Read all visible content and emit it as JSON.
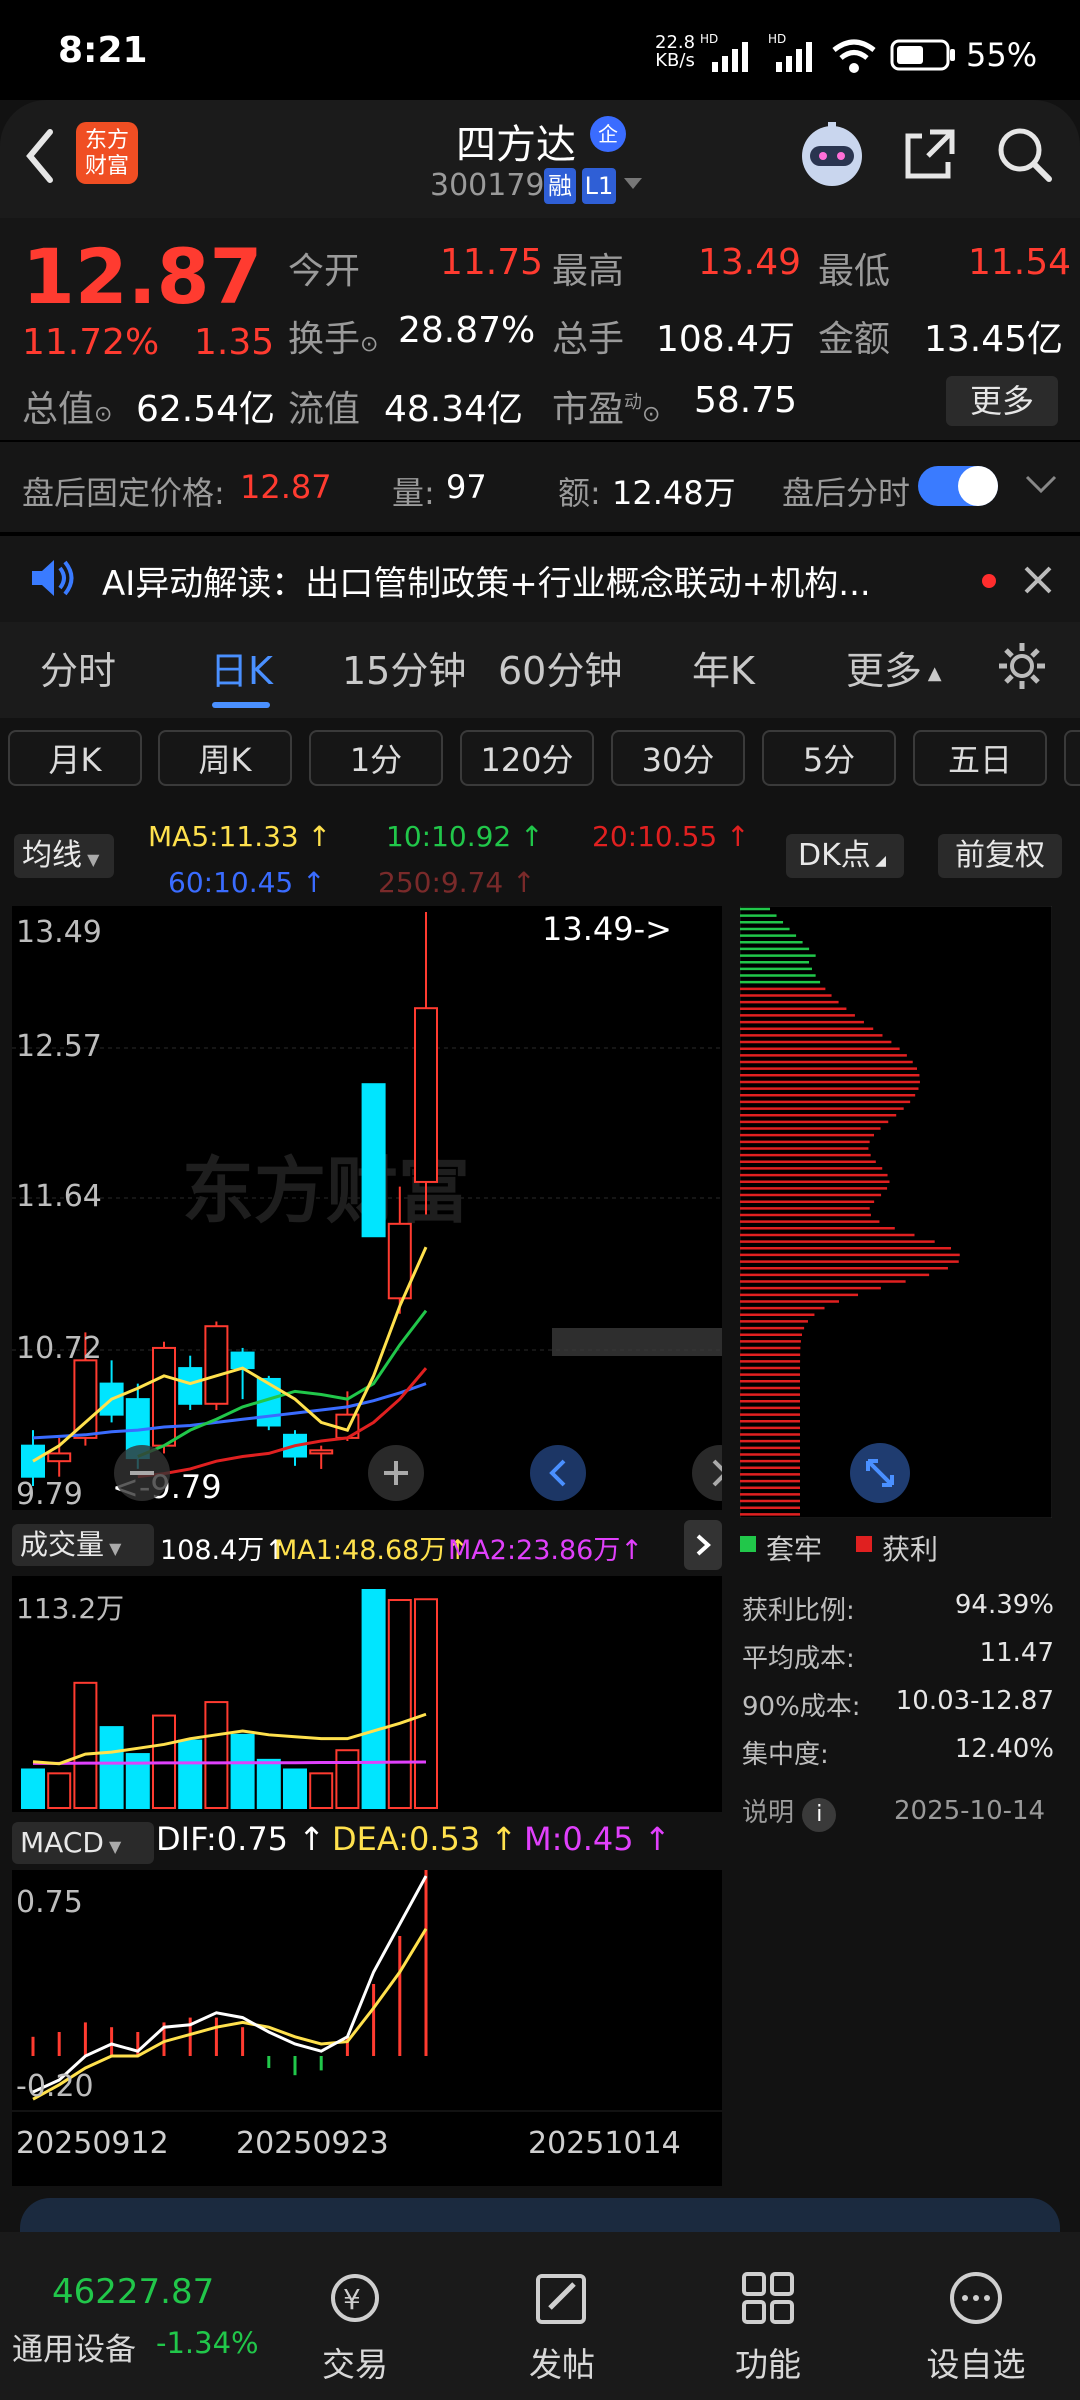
{
  "status": {
    "time": "8:21",
    "net_speed": "22.8",
    "net_unit": "KB/s",
    "hd1": "HD",
    "hd2": "HD",
    "battery": "55%"
  },
  "header": {
    "logo_line1": "东方",
    "logo_line2": "财富",
    "title": "四方达",
    "title_badge": "企",
    "code": "300179",
    "tag_rong": "融",
    "tag_level": "L1"
  },
  "quote": {
    "price": "12.87",
    "pct": "11.72%",
    "change": "1.35",
    "open_label": "今开",
    "open": "11.75",
    "high_label": "最高",
    "high": "13.49",
    "low_label": "最低",
    "low": "11.54",
    "turnover_label": "换手",
    "turnover": "28.87%",
    "volume_label": "总手",
    "volume": "108.4万",
    "amount_label": "金额",
    "amount": "13.45亿",
    "mktcap_label": "总值",
    "mktcap": "62.54亿",
    "float_label": "流值",
    "float": "48.34亿",
    "pe_label": "市盈",
    "pe_sup": "动",
    "pe": "58.75",
    "more": "更多"
  },
  "after_hours": {
    "price_label": "盘后固定价格:",
    "price": "12.87",
    "vol_label": "量:",
    "vol": "97",
    "amt_label": "额:",
    "amt": "12.48万",
    "toggle_label": "盘后分时"
  },
  "ai_banner": {
    "text": "AI异动解读：出口管制政策+行业概念联动+机构..."
  },
  "tabs": [
    {
      "label": "分时"
    },
    {
      "label": "日K"
    },
    {
      "label": "15分钟"
    },
    {
      "label": "60分钟"
    },
    {
      "label": "年K"
    },
    {
      "label": "更多"
    }
  ],
  "chips": [
    {
      "label": "月K"
    },
    {
      "label": "周K"
    },
    {
      "label": "1分"
    },
    {
      "label": "120分"
    },
    {
      "label": "30分"
    },
    {
      "label": "5分"
    },
    {
      "label": "五日"
    }
  ],
  "ma_legend": {
    "selector": "均线",
    "ma5": "MA5:11.33",
    "ma10": "10:10.92",
    "ma20": "20:10.55",
    "ma60": "60:10.45",
    "ma250": "250:9.74",
    "dk": "DK点",
    "fq": "前复权"
  },
  "kline_axis": {
    "y1": "13.49",
    "y2": "12.57",
    "y3": "11.64",
    "y4": "10.72",
    "y5": "9.79",
    "max_mark": "13.49->",
    "min_mark": "<-9.79",
    "watermark": "东方财富"
  },
  "vol_legend": {
    "selector": "成交量",
    "vol": "108.4万",
    "ma1": "MA1:48.68万",
    "ma2": "MA2:23.86万",
    "axis_top": "113.2万"
  },
  "macd_legend": {
    "selector": "MACD",
    "dif": "DIF:0.75",
    "dea": "DEA:0.53",
    "m": "M:0.45",
    "axis_top": "0.75",
    "axis_bottom": "-0.20"
  },
  "dates": [
    "20250912",
    "20250923",
    "20251014"
  ],
  "chip_panel": {
    "legend_trap": "套牢",
    "legend_profit": "获利",
    "rows": [
      {
        "label": "获利比例:",
        "value": "94.39%"
      },
      {
        "label": "平均成本:",
        "value": "11.47"
      },
      {
        "label": "90%成本:",
        "value": "10.03-12.87"
      },
      {
        "label": "集中度:",
        "value": "12.40%"
      }
    ],
    "note_label": "说明",
    "date": "2025-10-14"
  },
  "bottom_bar": {
    "index_value": "46227.87",
    "index_name": "通用设备",
    "index_pct": "-1.34%",
    "items": [
      {
        "label": "交易"
      },
      {
        "label": "发帖"
      },
      {
        "label": "功能"
      },
      {
        "label": "设自选"
      }
    ]
  },
  "colors": {
    "up": "#ff3b30",
    "down": "#00e5ff",
    "ma5": "#ffe14d",
    "ma10": "#21c74a",
    "ma20": "#e02020",
    "ma60": "#3a6cff",
    "accent": "#4a90ff"
  },
  "chart_data": {
    "type": "candlestick",
    "y_range": [
      9.79,
      13.49
    ],
    "candles": [
      {
        "o": 10.05,
        "c": 9.85,
        "h": 10.15,
        "l": 9.79
      },
      {
        "o": 9.95,
        "c": 10.0,
        "h": 10.1,
        "l": 9.85
      },
      {
        "o": 10.1,
        "c": 10.6,
        "h": 10.78,
        "l": 10.05
      },
      {
        "o": 10.45,
        "c": 10.25,
        "h": 10.6,
        "l": 10.2
      },
      {
        "o": 10.35,
        "c": 9.97,
        "h": 10.45,
        "l": 9.9
      },
      {
        "o": 10.05,
        "c": 10.68,
        "h": 10.72,
        "l": 10.0
      },
      {
        "o": 10.55,
        "c": 10.32,
        "h": 10.63,
        "l": 10.28
      },
      {
        "o": 10.32,
        "c": 10.82,
        "h": 10.85,
        "l": 10.28
      },
      {
        "o": 10.65,
        "c": 10.55,
        "h": 10.68,
        "l": 10.35
      },
      {
        "o": 10.48,
        "c": 10.18,
        "h": 10.5,
        "l": 10.15
      },
      {
        "o": 10.12,
        "c": 9.98,
        "h": 10.15,
        "l": 9.92
      },
      {
        "o": 10.0,
        "c": 10.02,
        "h": 10.05,
        "l": 9.9
      },
      {
        "o": 10.1,
        "c": 10.25,
        "h": 10.4,
        "l": 10.08
      },
      {
        "o": 12.38,
        "c": 11.4,
        "h": 12.38,
        "l": 11.4
      },
      {
        "o": 11.0,
        "c": 11.48,
        "h": 11.72,
        "l": 10.9
      },
      {
        "o": 11.75,
        "c": 12.87,
        "h": 13.49,
        "l": 11.54
      }
    ],
    "ma5": [
      9.95,
      10.05,
      10.2,
      10.35,
      10.42,
      10.5,
      10.45,
      10.5,
      10.55,
      10.45,
      10.35,
      10.2,
      10.15,
      10.5,
      10.95,
      11.33
    ],
    "ma10": [
      null,
      null,
      null,
      null,
      9.98,
      10.05,
      10.15,
      10.22,
      10.3,
      10.35,
      10.4,
      10.38,
      10.35,
      10.45,
      10.7,
      10.92
    ],
    "ma20": [
      null,
      null,
      null,
      null,
      9.85,
      9.87,
      9.9,
      9.95,
      9.98,
      10.0,
      10.05,
      10.08,
      10.1,
      10.2,
      10.35,
      10.55
    ],
    "ma60": [
      10.1,
      10.11,
      10.12,
      10.14,
      10.15,
      10.17,
      10.18,
      10.2,
      10.22,
      10.24,
      10.26,
      10.28,
      10.3,
      10.34,
      10.39,
      10.45
    ],
    "volume": [
      20,
      18,
      65,
      42,
      28,
      48,
      35,
      55,
      38,
      25,
      20,
      18,
      30,
      113.2,
      108,
      108.4
    ],
    "vol_ma1": [
      24,
      23,
      28,
      29,
      31,
      33,
      36,
      38,
      40,
      38,
      37,
      36,
      36,
      40,
      44,
      48.68
    ],
    "vol_ma2": [
      23.2,
      23.2,
      23.3,
      23.3,
      23.3,
      23.4,
      23.4,
      23.4,
      23.5,
      23.5,
      23.5,
      23.6,
      23.6,
      23.7,
      23.8,
      23.86
    ],
    "macd_hist": [
      0.08,
      0.1,
      0.14,
      0.12,
      0.1,
      0.14,
      0.16,
      0.16,
      0.12,
      -0.05,
      -0.08,
      -0.06,
      0.08,
      0.3,
      0.5,
      0.9
    ],
    "dif": [
      -0.15,
      -0.1,
      0.0,
      0.05,
      0.02,
      0.12,
      0.13,
      0.18,
      0.16,
      0.1,
      0.05,
      0.02,
      0.08,
      0.35,
      0.55,
      0.75
    ],
    "dea": [
      -0.18,
      -0.12,
      -0.05,
      0.0,
      0.0,
      0.06,
      0.09,
      0.12,
      0.14,
      0.12,
      0.08,
      0.05,
      0.06,
      0.2,
      0.35,
      0.53
    ],
    "macd_range": [
      -0.2,
      0.75
    ]
  }
}
